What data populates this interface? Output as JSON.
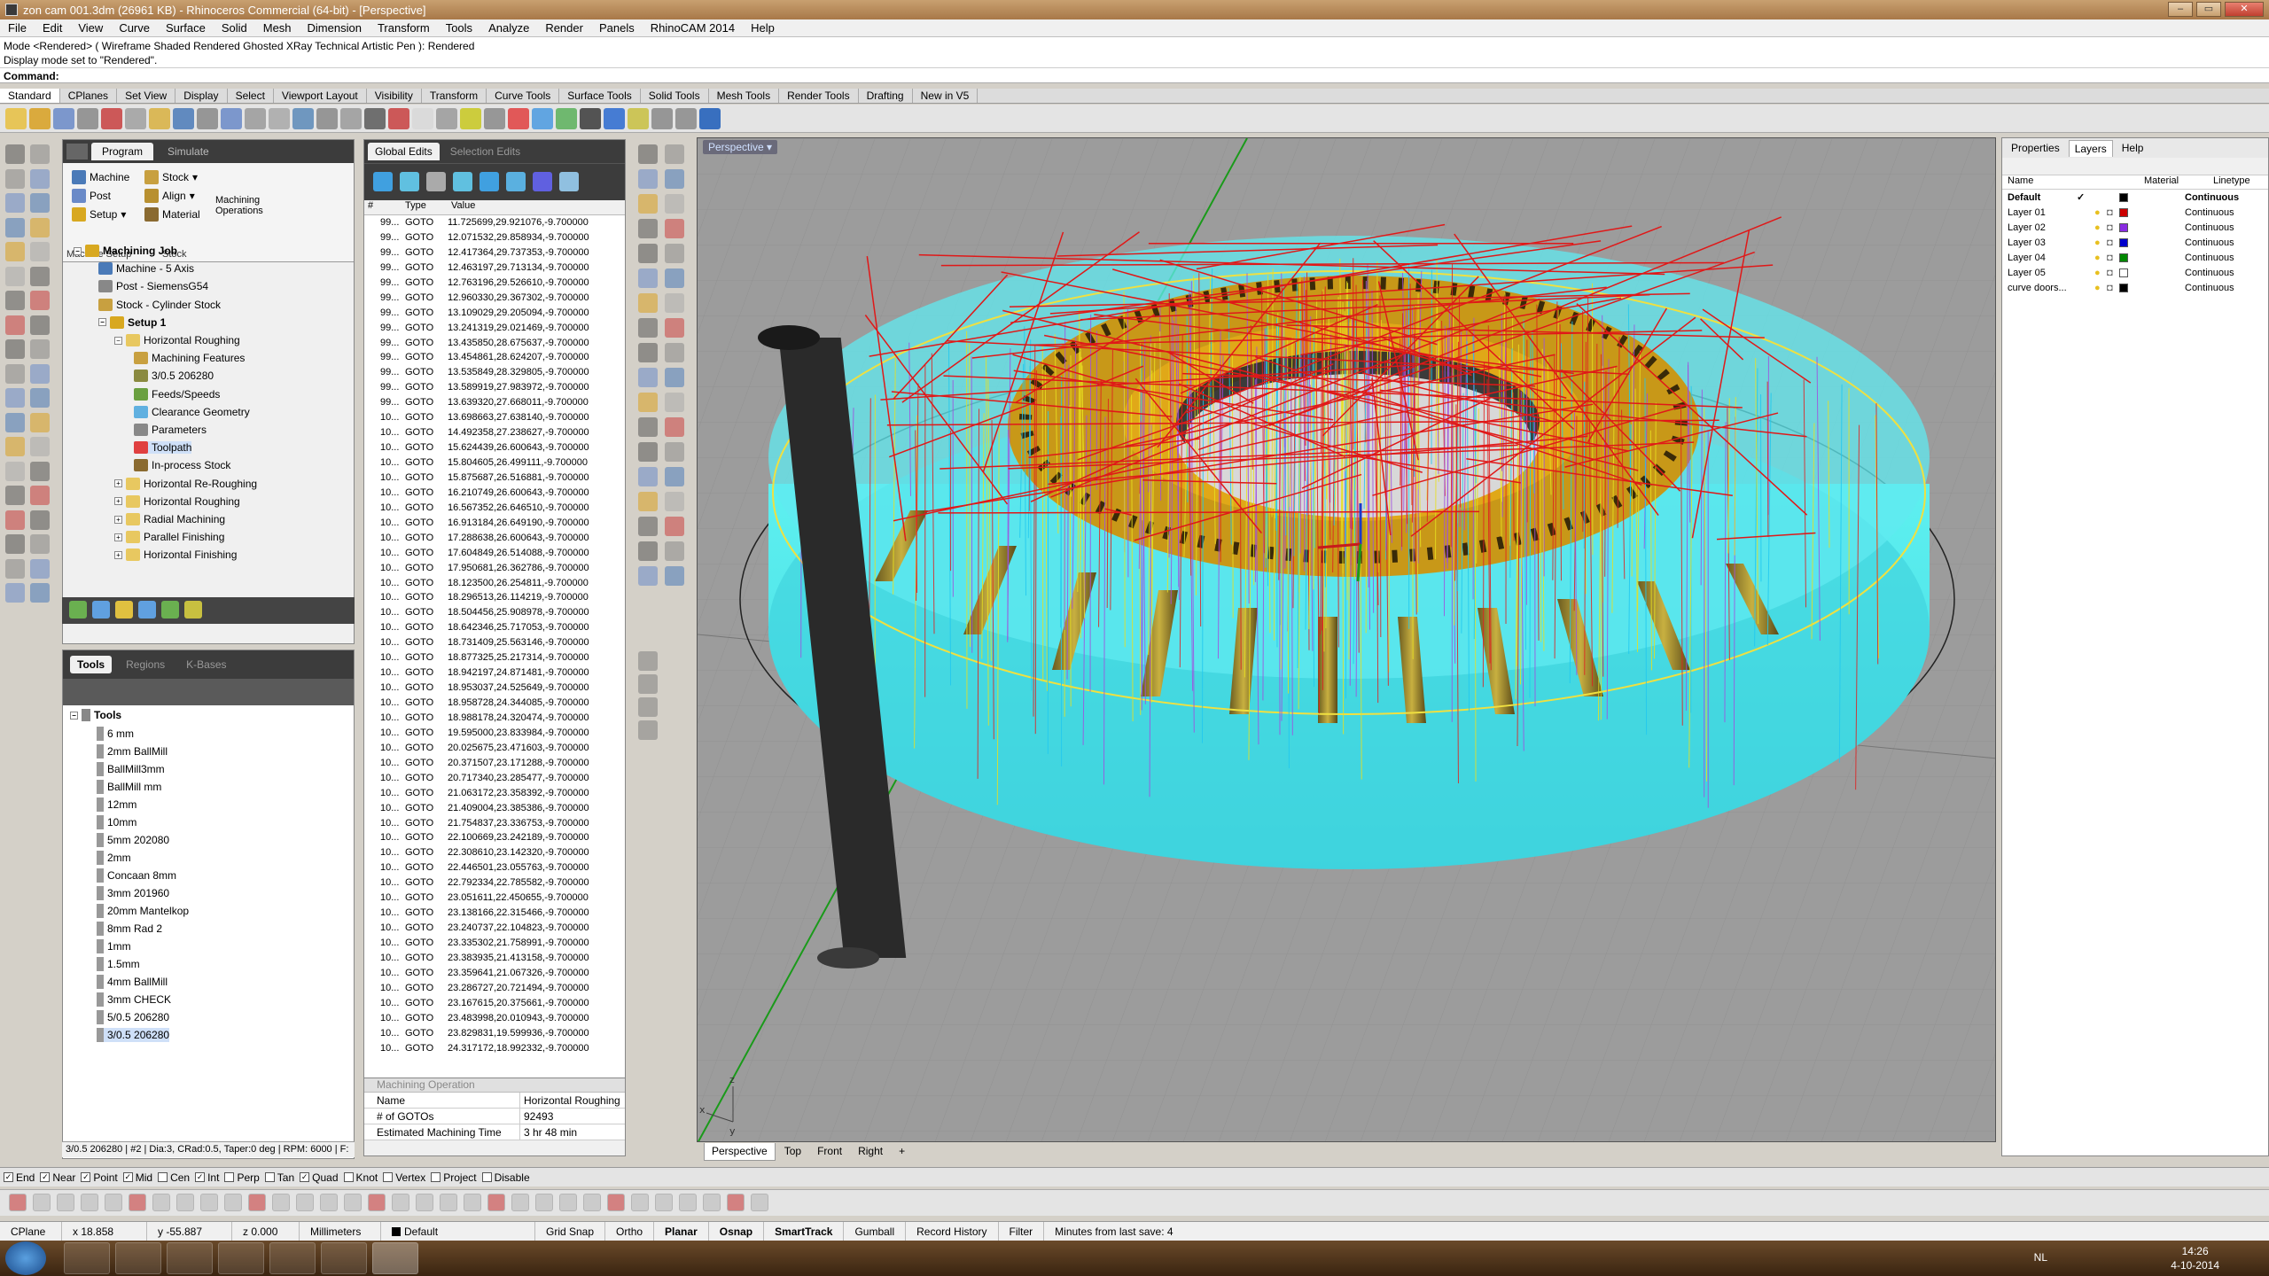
{
  "window": {
    "title": "zon cam 001.3dm (26961 KB) - Rhinoceros Commercial (64-bit) - [Perspective]"
  },
  "menu": [
    "File",
    "Edit",
    "View",
    "Curve",
    "Surface",
    "Solid",
    "Mesh",
    "Dimension",
    "Transform",
    "Tools",
    "Analyze",
    "Render",
    "Panels",
    "RhinoCAM 2014",
    "Help"
  ],
  "command": {
    "history_1": "Mode <Rendered> ( Wireframe  Shaded  Rendered  Ghosted  XRay  Technical  Artistic  Pen ): Rendered",
    "history_2": "Display mode set to \"Rendered\".",
    "prompt": "Command:"
  },
  "toolbar_tabs": [
    "Standard",
    "CPlanes",
    "Set View",
    "Display",
    "Select",
    "Viewport Layout",
    "Visibility",
    "Transform",
    "Curve Tools",
    "Surface Tools",
    "Solid Tools",
    "Mesh Tools",
    "Render Tools",
    "Drafting",
    "New in V5"
  ],
  "program_panel": {
    "tabs": [
      "Program",
      "Simulate"
    ],
    "ribbon": {
      "machine": "Machine",
      "post": "Post",
      "setup": "Setup",
      "machine_setup_group": "Machine Setup",
      "stock": "Stock",
      "align": "Align",
      "material": "Material",
      "stock_group": "Stock",
      "machining_operations": "Machining Operations"
    },
    "tree": [
      {
        "label": "Machining Job",
        "bold": true
      },
      {
        "label": "Machine - 5 Axis"
      },
      {
        "label": "Post - SiemensG54"
      },
      {
        "label": "Stock - Cylinder Stock"
      },
      {
        "label": "Setup 1",
        "bold": true
      },
      {
        "label": "Horizontal Roughing"
      },
      {
        "label": "Machining Features"
      },
      {
        "label": "3/0.5 206280"
      },
      {
        "label": "Feeds/Speeds"
      },
      {
        "label": "Clearance Geometry"
      },
      {
        "label": "Parameters"
      },
      {
        "label": "Toolpath"
      },
      {
        "label": "In-process Stock"
      },
      {
        "label": "Horizontal Re-Roughing"
      },
      {
        "label": "Horizontal Roughing"
      },
      {
        "label": "Radial Machining"
      },
      {
        "label": "Parallel Finishing"
      },
      {
        "label": "Horizontal Finishing"
      }
    ]
  },
  "tools_panel": {
    "tabs": [
      "Tools",
      "Regions",
      "K-Bases"
    ],
    "root": "Tools",
    "items": [
      "6 mm",
      "2mm BallMill",
      "BallMill3mm",
      "BallMill mm",
      "12mm",
      "10mm",
      "5mm 202080",
      "2mm",
      "Concaan 8mm",
      "3mm 201960",
      "20mm Mantelkop",
      "8mm Rad 2",
      "1mm",
      "1.5mm",
      "4mm BallMill",
      "3mm CHECK",
      "5/0.5 206280",
      "3/0.5 206280"
    ],
    "status": "3/0.5 206280 | #2 | Dia:3, CRad:0.5, Taper:0 deg | RPM: 6000 | F:"
  },
  "goto_panel": {
    "tabs": [
      "Global Edits",
      "Selection Edits"
    ],
    "columns": [
      "#",
      "Type",
      "Value"
    ],
    "rows": [
      [
        "99...",
        "GOTO",
        "11.725699,29.921076,-9.700000"
      ],
      [
        "99...",
        "GOTO",
        "12.071532,29.858934,-9.700000"
      ],
      [
        "99...",
        "GOTO",
        "12.417364,29.737353,-9.700000"
      ],
      [
        "99...",
        "GOTO",
        "12.463197,29.713134,-9.700000"
      ],
      [
        "99...",
        "GOTO",
        "12.763196,29.526610,-9.700000"
      ],
      [
        "99...",
        "GOTO",
        "12.960330,29.367302,-9.700000"
      ],
      [
        "99...",
        "GOTO",
        "13.109029,29.205094,-9.700000"
      ],
      [
        "99...",
        "GOTO",
        "13.241319,29.021469,-9.700000"
      ],
      [
        "99...",
        "GOTO",
        "13.435850,28.675637,-9.700000"
      ],
      [
        "99...",
        "GOTO",
        "13.454861,28.624207,-9.700000"
      ],
      [
        "99...",
        "GOTO",
        "13.535849,28.329805,-9.700000"
      ],
      [
        "99...",
        "GOTO",
        "13.589919,27.983972,-9.700000"
      ],
      [
        "99...",
        "GOTO",
        "13.639320,27.668011,-9.700000"
      ],
      [
        "10...",
        "GOTO",
        "13.698663,27.638140,-9.700000"
      ],
      [
        "10...",
        "GOTO",
        "14.492358,27.238627,-9.700000"
      ],
      [
        "10...",
        "GOTO",
        "15.624439,26.600643,-9.700000"
      ],
      [
        "10...",
        "GOTO",
        "15.804605,26.499111,-9.700000"
      ],
      [
        "10...",
        "GOTO",
        "15.875687,26.516881,-9.700000"
      ],
      [
        "10...",
        "GOTO",
        "16.210749,26.600643,-9.700000"
      ],
      [
        "10...",
        "GOTO",
        "16.567352,26.646510,-9.700000"
      ],
      [
        "10...",
        "GOTO",
        "16.913184,26.649190,-9.700000"
      ],
      [
        "10...",
        "GOTO",
        "17.288638,26.600643,-9.700000"
      ],
      [
        "10...",
        "GOTO",
        "17.604849,26.514088,-9.700000"
      ],
      [
        "10...",
        "GOTO",
        "17.950681,26.362786,-9.700000"
      ],
      [
        "10...",
        "GOTO",
        "18.123500,26.254811,-9.700000"
      ],
      [
        "10...",
        "GOTO",
        "18.296513,26.114219,-9.700000"
      ],
      [
        "10...",
        "GOTO",
        "18.504456,25.908978,-9.700000"
      ],
      [
        "10...",
        "GOTO",
        "18.642346,25.717053,-9.700000"
      ],
      [
        "10...",
        "GOTO",
        "18.731409,25.563146,-9.700000"
      ],
      [
        "10...",
        "GOTO",
        "18.877325,25.217314,-9.700000"
      ],
      [
        "10...",
        "GOTO",
        "18.942197,24.871481,-9.700000"
      ],
      [
        "10...",
        "GOTO",
        "18.953037,24.525649,-9.700000"
      ],
      [
        "10...",
        "GOTO",
        "18.958728,24.344085,-9.700000"
      ],
      [
        "10...",
        "GOTO",
        "18.988178,24.320474,-9.700000"
      ],
      [
        "10...",
        "GOTO",
        "19.595000,23.833984,-9.700000"
      ],
      [
        "10...",
        "GOTO",
        "20.025675,23.471603,-9.700000"
      ],
      [
        "10...",
        "GOTO",
        "20.371507,23.171288,-9.700000"
      ],
      [
        "10...",
        "GOTO",
        "20.717340,23.285477,-9.700000"
      ],
      [
        "10...",
        "GOTO",
        "21.063172,23.358392,-9.700000"
      ],
      [
        "10...",
        "GOTO",
        "21.409004,23.385386,-9.700000"
      ],
      [
        "10...",
        "GOTO",
        "21.754837,23.336753,-9.700000"
      ],
      [
        "10...",
        "GOTO",
        "22.100669,23.242189,-9.700000"
      ],
      [
        "10...",
        "GOTO",
        "22.308610,23.142320,-9.700000"
      ],
      [
        "10...",
        "GOTO",
        "22.446501,23.055763,-9.700000"
      ],
      [
        "10...",
        "GOTO",
        "22.792334,22.785582,-9.700000"
      ],
      [
        "10...",
        "GOTO",
        "23.051611,22.450655,-9.700000"
      ],
      [
        "10...",
        "GOTO",
        "23.138166,22.315466,-9.700000"
      ],
      [
        "10...",
        "GOTO",
        "23.240737,22.104823,-9.700000"
      ],
      [
        "10...",
        "GOTO",
        "23.335302,21.758991,-9.700000"
      ],
      [
        "10...",
        "GOTO",
        "23.383935,21.413158,-9.700000"
      ],
      [
        "10...",
        "GOTO",
        "23.359641,21.067326,-9.700000"
      ],
      [
        "10...",
        "GOTO",
        "23.286727,20.721494,-9.700000"
      ],
      [
        "10...",
        "GOTO",
        "23.167615,20.375661,-9.700000"
      ],
      [
        "10...",
        "GOTO",
        "23.483998,20.010943,-9.700000"
      ],
      [
        "10...",
        "GOTO",
        "23.829831,19.599936,-9.700000"
      ],
      [
        "10...",
        "GOTO",
        "24.317172,18.992332,-9.700000"
      ]
    ]
  },
  "machining_operation": {
    "header": "Machining Operation",
    "rows": [
      [
        "Name",
        "Horizontal Roughing"
      ],
      [
        "# of GOTOs",
        "92493"
      ],
      [
        "Estimated Machining Time",
        "3 hr 48 min"
      ]
    ]
  },
  "viewport": {
    "label": "Perspective",
    "tabs": [
      "Perspective",
      "Top",
      "Front",
      "Right"
    ]
  },
  "layers_panel": {
    "tabs": [
      "Properties",
      "Layers",
      "Help"
    ],
    "columns": [
      "Name",
      "Material",
      "Linetype"
    ],
    "rows": [
      {
        "name": "Default",
        "linetype": "Continuous",
        "color": "#000000",
        "current": true
      },
      {
        "name": "Layer 01",
        "linetype": "Continuous",
        "color": "#cc0000"
      },
      {
        "name": "Layer 02",
        "linetype": "Continuous",
        "color": "#8a2be2"
      },
      {
        "name": "Layer 03",
        "linetype": "Continuous",
        "color": "#0000cc"
      },
      {
        "name": "Layer 04",
        "linetype": "Continuous",
        "color": "#008800"
      },
      {
        "name": "Layer 05",
        "linetype": "Continuous",
        "color": "#ffffff"
      },
      {
        "name": "curve doors...",
        "linetype": "Continuous",
        "color": "#000000"
      }
    ]
  },
  "osnaps": [
    {
      "label": "End",
      "checked": true
    },
    {
      "label": "Near",
      "checked": true
    },
    {
      "label": "Point",
      "checked": true
    },
    {
      "label": "Mid",
      "checked": true
    },
    {
      "label": "Cen",
      "checked": false
    },
    {
      "label": "Int",
      "checked": true
    },
    {
      "label": "Perp",
      "checked": false
    },
    {
      "label": "Tan",
      "checked": false
    },
    {
      "label": "Quad",
      "checked": true
    },
    {
      "label": "Knot",
      "checked": false
    },
    {
      "label": "Vertex",
      "checked": false
    },
    {
      "label": "Project",
      "checked": false
    },
    {
      "label": "Disable",
      "checked": false
    }
  ],
  "statusbar": {
    "cplane": "CPlane",
    "x": "x 18.858",
    "y": "y -55.887",
    "z": "z 0.000",
    "units": "Millimeters",
    "layer": "Default",
    "grid_snap": "Grid Snap",
    "ortho": "Ortho",
    "planar": "Planar",
    "osnap": "Osnap",
    "smarttrack": "SmartTrack",
    "gumball": "Gumball",
    "record_history": "Record History",
    "filter": "Filter",
    "autosave": "Minutes from last save: 4"
  },
  "taskbar": {
    "lang": "NL",
    "time": "14:26",
    "date": "4-10-2014"
  }
}
